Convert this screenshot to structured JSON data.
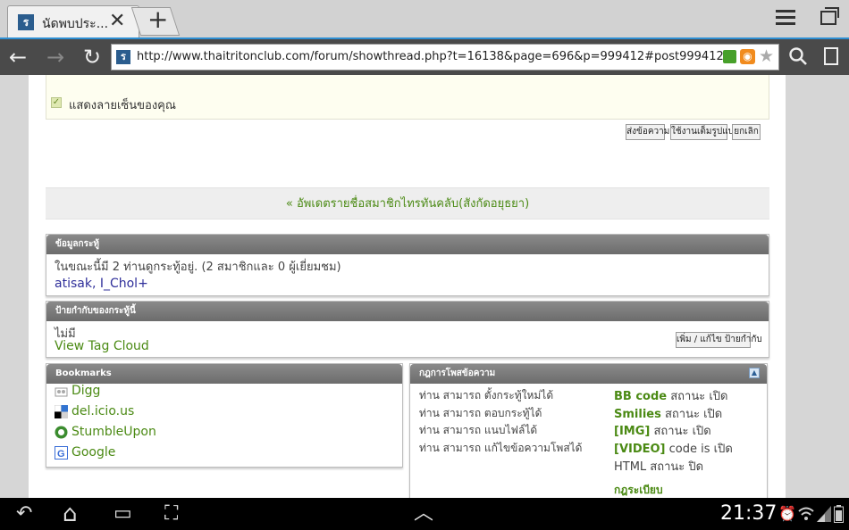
{
  "browser": {
    "tab_title": "นัดพบประ...",
    "tab_favicon": "ร",
    "close_symbol": "✕",
    "newtab_symbol": "+",
    "url": "http://www.thaitritonclub.com/forum/showthread.php?t=16138&page=696&p=999412#post999412",
    "url_favicon": "ร",
    "rss_symbol": "◉",
    "star_symbol": "★",
    "back_symbol": "←",
    "forward_symbol": "→",
    "reload_symbol": "↻"
  },
  "editor": {
    "signature_check_symbol": "✓",
    "signature_label": "แสดงลายเซ็นของคุณ",
    "submit_label": "ส่งข้อความ",
    "advanced_label": "ใช้งานเต็มรูปแบบ",
    "cancel_label": "ยกเลิก"
  },
  "next_thread": {
    "arrow": "«",
    "label": "อัพเดตรายชื่อสมาชิกไทรทันคลับ(สังกัดอยุธยา)"
  },
  "thread_info": {
    "title": "ข้อมูลกระทู้",
    "viewing": "ในขณะนี้มี 2 ท่านดูกระทู้อยู่. (2 สมาชิกและ 0 ผู้เยี่ยมชม)",
    "members": "atisak, I_Chol+"
  },
  "tags": {
    "title": "ป้ายกำกับของกระทู้นี้",
    "none": "ไม่มี",
    "cloud_link": "View Tag Cloud",
    "edit_button": "เพิ่ม / แก้ไข ป้ายกำกับ"
  },
  "bookmarks": {
    "title": "Bookmarks",
    "items": [
      {
        "label": "Digg",
        "icon": "digg-icon"
      },
      {
        "label": "del.icio.us",
        "icon": "delicious-icon"
      },
      {
        "label": "StumbleUpon",
        "icon": "stumbleupon-icon"
      },
      {
        "label": "Google",
        "icon": "google-icon"
      }
    ]
  },
  "rules": {
    "title": "กฎการโพสข้อความ",
    "collapse_symbol": "▲",
    "permissions": [
      "ท่าน สามารถ ตั้งกระทู้ใหม่ได้",
      "ท่าน สามารถ ตอบกระทู้ได้",
      "ท่าน สามารถ แนบไฟล์ได้",
      "ท่าน สามารถ แก้ไขข้อความโพสได้"
    ],
    "settings": [
      {
        "name": "BB code",
        "value": "สถานะ เปิด"
      },
      {
        "name": "Smilies",
        "value": "สถานะ เปิด"
      },
      {
        "name": "[IMG]",
        "value": "สถานะ เปิด"
      },
      {
        "name": "[VIDEO]",
        "value": "code is เปิด"
      },
      {
        "name": "",
        "value": "HTML สถานะ ปิด"
      }
    ],
    "forum_rules_link": "กฎระเบียบ"
  },
  "system_bar": {
    "clock": "21:37",
    "back_symbol": "↶",
    "home_symbol": "⌂",
    "recent_symbol": "▭",
    "screenshot_symbol": "⛶",
    "up_symbol": "︿",
    "alarm_symbol": "⏰"
  },
  "colors": {
    "link_green": "#4b8a14",
    "link_blue": "#2f2f9a",
    "box_header": "#7a7a7a",
    "address_bar": "#4a4a4a",
    "accent_blue": "#2e8fd3"
  }
}
